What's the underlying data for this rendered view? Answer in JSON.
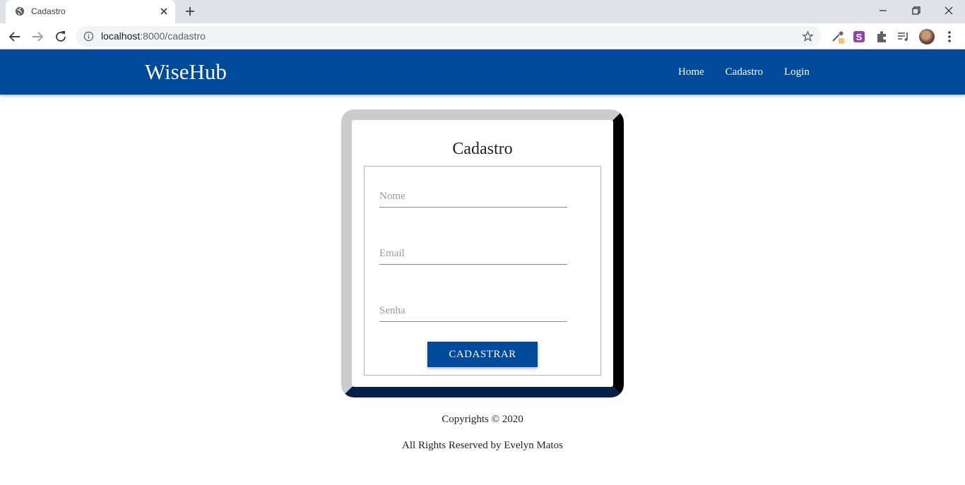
{
  "browser": {
    "tab_title": "Cadastro",
    "url_host": "localhost",
    "url_path": ":8000/cadastro"
  },
  "navbar": {
    "brand": "WiseHub",
    "links": [
      "Home",
      "Cadastro",
      "Login"
    ],
    "color": "#004a9c"
  },
  "form": {
    "title": "Cadastro",
    "name_placeholder": "Nome",
    "email_placeholder": "Email",
    "password_placeholder": "Senha",
    "submit_label": "CADASTRAR"
  },
  "footer": {
    "copyright": "Copyrights © 2020",
    "rights": "All Rights Reserved by Evelyn Matos"
  },
  "icons": {
    "tab_favicon": "globe-icon",
    "tab_close": "close-icon",
    "new_tab": "plus-icon",
    "back": "arrow-left-icon",
    "forward": "arrow-right-icon",
    "reload": "reload-icon",
    "site_info": "info-icon",
    "bookmark": "star-icon",
    "extensions": [
      "eyedropper-icon",
      "s-extension-icon",
      "puzzle-icon",
      "media-queue-icon"
    ],
    "menu": "kebab-menu-icon"
  }
}
